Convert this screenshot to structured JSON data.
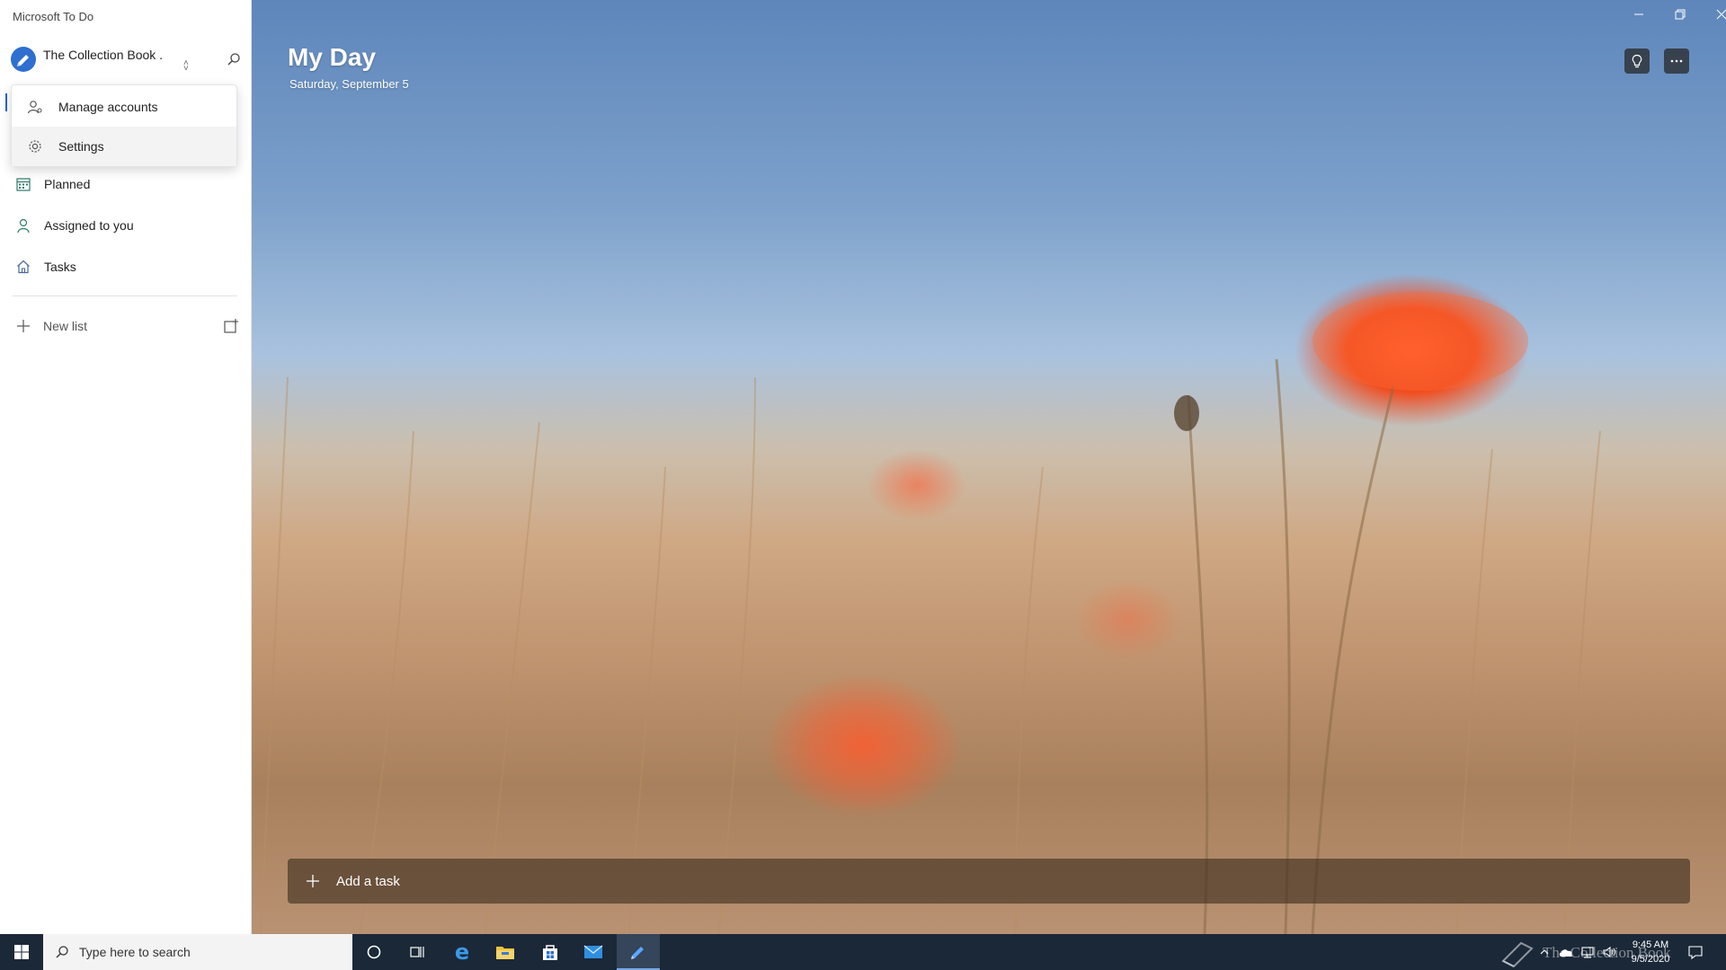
{
  "app": {
    "title": "Microsoft To Do"
  },
  "account": {
    "name": "The Collection Book ."
  },
  "account_menu": {
    "items": [
      {
        "label": "Manage accounts",
        "icon": "manage-accounts-icon"
      },
      {
        "label": "Settings",
        "icon": "gear-icon"
      }
    ]
  },
  "sidebar": {
    "items": [
      {
        "label": "Planned",
        "icon": "calendar-icon"
      },
      {
        "label": "Assigned to you",
        "icon": "person-icon"
      },
      {
        "label": "Tasks",
        "icon": "home-icon"
      }
    ],
    "new_list_label": "New list"
  },
  "main": {
    "title": "My Day",
    "date": "Saturday, September 5",
    "add_task_label": "Add a task"
  },
  "taskbar": {
    "search_placeholder": "Type here to search",
    "watermark": "The Collection Book",
    "time": "9:45 AM",
    "date": "9/5/2020"
  },
  "colors": {
    "accent": "#2564cf",
    "taskbar": "#1b2838",
    "sidebar_bg": "#ffffff"
  }
}
